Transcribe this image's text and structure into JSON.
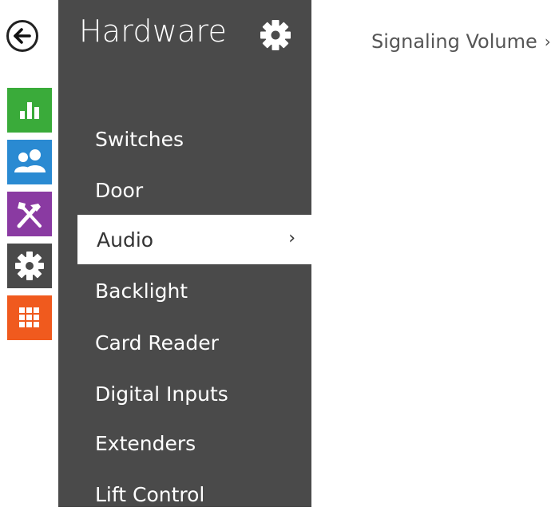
{
  "rail": {
    "back_icon": "arrow-left-icon",
    "items": [
      {
        "icon": "bar-chart-icon",
        "color": "#3aab3a"
      },
      {
        "icon": "users-icon",
        "color": "#2a8ad2"
      },
      {
        "icon": "tools-icon",
        "color": "#8a3aa2"
      },
      {
        "icon": "gear-icon",
        "color": "#4a4a4a"
      },
      {
        "icon": "grid-icon",
        "color": "#f05a1e"
      }
    ]
  },
  "panel": {
    "title": "Hardware",
    "title_icon": "gear-icon",
    "background": "#4a4a4a",
    "items": [
      {
        "label": "Switches"
      },
      {
        "label": "Door"
      },
      {
        "label": "Audio",
        "active": true,
        "chevron": "›"
      },
      {
        "label": "Backlight"
      },
      {
        "label": "Card Reader"
      },
      {
        "label": "Digital Inputs"
      },
      {
        "label": "Extenders"
      },
      {
        "label": "Lift Control"
      }
    ]
  },
  "content": {
    "sub_link": "Signaling Volume",
    "sub_link_chevron": "›"
  }
}
